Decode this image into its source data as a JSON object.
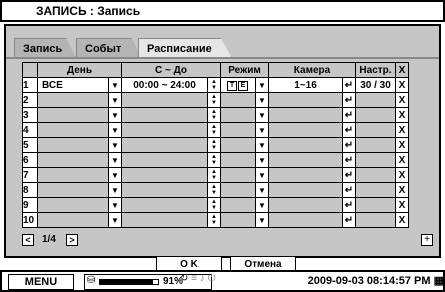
{
  "title": "ЗАПИСЬ : Запись",
  "tabs": [
    {
      "label": "Запись",
      "active": false
    },
    {
      "label": "Событ",
      "active": false
    },
    {
      "label": "Расписание",
      "active": true
    }
  ],
  "table": {
    "headers": {
      "num": "",
      "day": "День",
      "from_to": "С ~ До",
      "mode": "Режим",
      "camera": "Камера",
      "settings": "Настр.",
      "delete": "X"
    },
    "rows": [
      {
        "num": "1",
        "day": "ВСЕ",
        "time": "00:00 ~ 24:00",
        "mode": "TE",
        "camera": "1~16",
        "settings": "30 / 30"
      },
      {
        "num": "2",
        "day": "",
        "time": "",
        "mode": "",
        "camera": "",
        "settings": ""
      },
      {
        "num": "3",
        "day": "",
        "time": "",
        "mode": "",
        "camera": "",
        "settings": ""
      },
      {
        "num": "4",
        "day": "",
        "time": "",
        "mode": "",
        "camera": "",
        "settings": ""
      },
      {
        "num": "5",
        "day": "",
        "time": "",
        "mode": "",
        "camera": "",
        "settings": ""
      },
      {
        "num": "6",
        "day": "",
        "time": "",
        "mode": "",
        "camera": "",
        "settings": ""
      },
      {
        "num": "7",
        "day": "",
        "time": "",
        "mode": "",
        "camera": "",
        "settings": ""
      },
      {
        "num": "8",
        "day": "",
        "time": "",
        "mode": "",
        "camera": "",
        "settings": ""
      },
      {
        "num": "9",
        "day": "",
        "time": "",
        "mode": "",
        "camera": "",
        "settings": ""
      },
      {
        "num": "10",
        "day": "",
        "time": "",
        "mode": "",
        "camera": "",
        "settings": ""
      }
    ]
  },
  "pager": {
    "text": "1/4",
    "prev": "<",
    "next": ">",
    "add": "+"
  },
  "buttons": {
    "ok": "O K",
    "cancel": "Отмена"
  },
  "statusbar": {
    "menu": "MENU",
    "disk_percent_text": "91%",
    "disk_fill": 0.91,
    "datetime": "2009-09-03 08:14:57 PM"
  },
  "colors": {
    "panel": "#c6c6c6",
    "field": "#ffffff",
    "border": "#000000"
  }
}
